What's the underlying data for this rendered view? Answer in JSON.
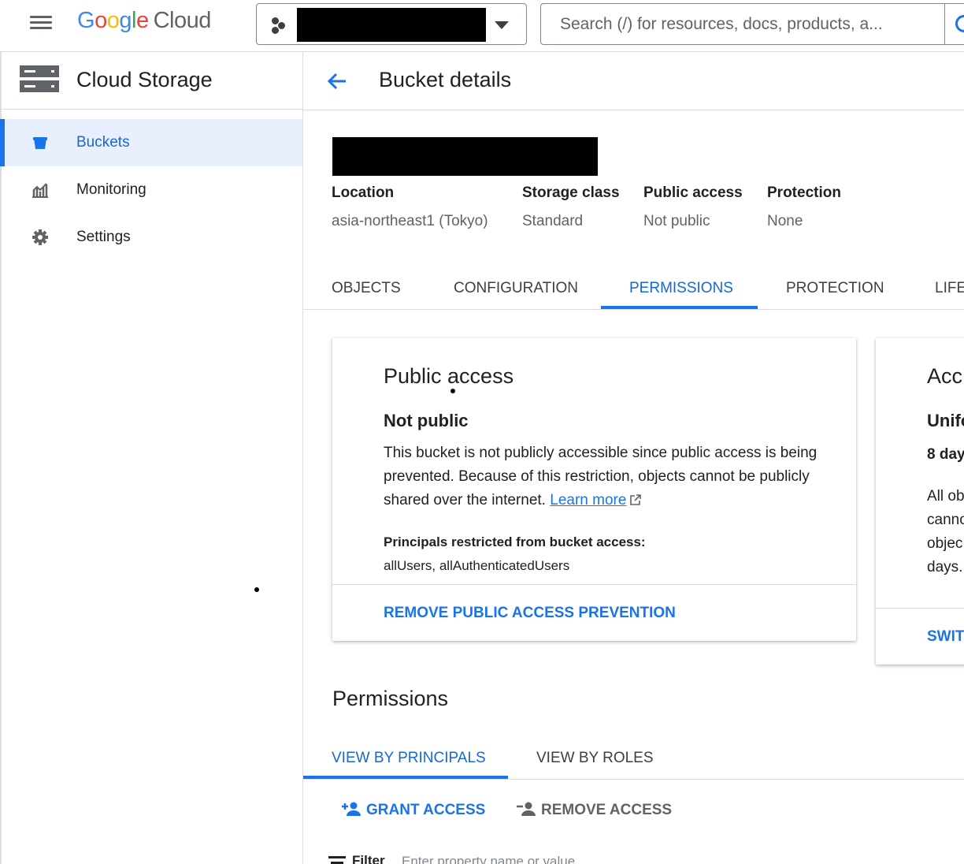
{
  "topbar": {
    "logo_parts": [
      "G",
      "o",
      "o",
      "g",
      "l",
      "e"
    ],
    "logo_cloud": "Cloud",
    "search_placeholder": "Search (/) for resources, docs, products, a..."
  },
  "sidebar": {
    "title": "Cloud Storage",
    "items": [
      {
        "label": "Buckets",
        "icon": "bucket-icon",
        "active": true
      },
      {
        "label": "Monitoring",
        "icon": "monitoring-icon",
        "active": false
      },
      {
        "label": "Settings",
        "icon": "gear-icon",
        "active": false
      }
    ]
  },
  "header": {
    "title": "Bucket details"
  },
  "bucket_info": {
    "location_label": "Location",
    "location_value": "asia-northeast1 (Tokyo)",
    "storage_class_label": "Storage class",
    "storage_class_value": "Standard",
    "public_access_label": "Public access",
    "public_access_value": "Not public",
    "protection_label": "Protection",
    "protection_value": "None"
  },
  "tabs": [
    {
      "label": "OBJECTS",
      "active": false
    },
    {
      "label": "CONFIGURATION",
      "active": false
    },
    {
      "label": "PERMISSIONS",
      "active": true
    },
    {
      "label": "PROTECTION",
      "active": false
    },
    {
      "label": "LIFE",
      "active": false
    }
  ],
  "public_access_card": {
    "title": "Public access",
    "status": "Not public",
    "description": "This bucket is not publicly accessible since public access is being prevented. Because of this restriction, objects cannot be publicly shared over the internet.",
    "learn_more": "Learn more",
    "principals_label": "Principals restricted from bucket access:",
    "principals_value": "allUsers, allAuthenticatedUsers",
    "action": "REMOVE PUBLIC ACCESS PREVENTION"
  },
  "access_control_card": {
    "title": "Acc",
    "subtitle": "Unifo",
    "days": "8 day",
    "body_lines": [
      "All ob",
      "canno",
      "objec",
      "days."
    ],
    "action": "SWIT"
  },
  "permissions": {
    "title": "Permissions",
    "tabs": [
      {
        "label": "VIEW BY PRINCIPALS",
        "active": true
      },
      {
        "label": "VIEW BY ROLES",
        "active": false
      }
    ],
    "grant_access": "GRANT ACCESS",
    "remove_access": "REMOVE ACCESS",
    "filter_label": "Filter",
    "filter_placeholder": "Enter property name or value"
  },
  "colors": {
    "accent": "#1a73e8",
    "active_bg": "#e8f0fe",
    "text_secondary": "#5f6368"
  }
}
